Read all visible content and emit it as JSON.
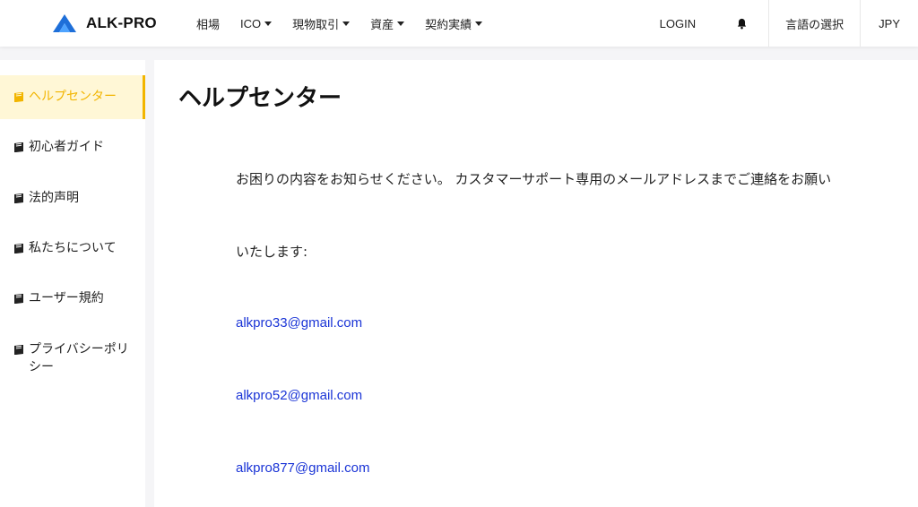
{
  "header": {
    "brand": "ALK-PRO",
    "nav": [
      {
        "label": "相場",
        "dropdown": false
      },
      {
        "label": "ICO",
        "dropdown": true
      },
      {
        "label": "現物取引",
        "dropdown": true
      },
      {
        "label": "資産",
        "dropdown": true
      },
      {
        "label": "契約実績",
        "dropdown": true
      }
    ],
    "login": "LOGIN",
    "language": "言語の選択",
    "currency": "JPY"
  },
  "sidebar": {
    "items": [
      {
        "label": "ヘルプセンター",
        "active": true
      },
      {
        "label": "初心者ガイド",
        "active": false
      },
      {
        "label": "法的声明",
        "active": false
      },
      {
        "label": "私たちについて",
        "active": false
      },
      {
        "label": "ユーザー規約",
        "active": false
      },
      {
        "label": "プライバシーポリシー",
        "active": false
      }
    ]
  },
  "main": {
    "title": "ヘルプセンター",
    "line1": "お困りの内容をお知らせください。 カスタマーサポート専用のメールアドレスまでご連絡をお願い",
    "line2": "いたします:",
    "emails": [
      "alkpro33@gmail.com",
      "alkpro52@gmail.com",
      "alkpro877@gmail.com"
    ]
  },
  "colors": {
    "accent": "#f2b500",
    "link": "#1a34d6",
    "brand_blue": "#1e6fd9"
  }
}
